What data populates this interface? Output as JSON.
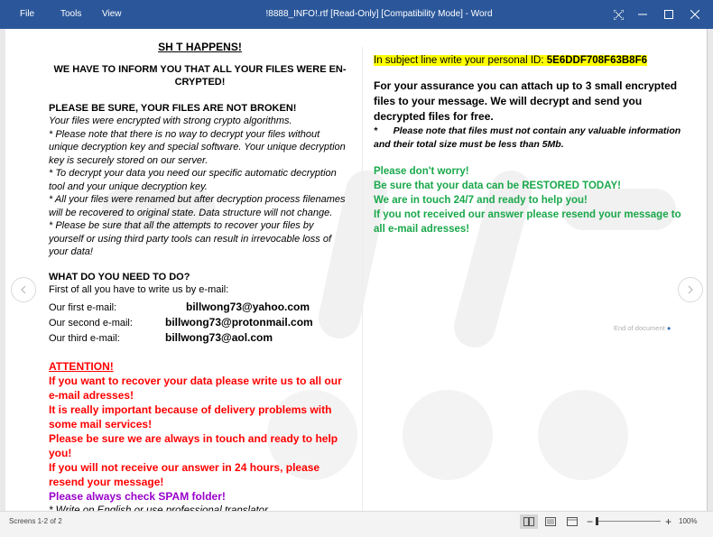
{
  "window": {
    "menu": [
      "File",
      "Tools",
      "View"
    ],
    "title": "!8888_INFO!.rtf [Read-Only] [Compatibility Mode] - Word"
  },
  "left": {
    "heading": "SH T HAPPENS!",
    "inform_line1": "WE HAVE TO INFORM YOU THAT ALL YOUR FILES WERE EN-",
    "inform_line2": "CRYPTED!",
    "sure_heading": "PLEASE BE SURE, YOUR FILES ARE NOT BROKEN!",
    "para1": "Your files were encrypted with strong crypto algorithms.",
    "para2": "* Please note that there is no way to decrypt your files without unique decryption key and special software. Your unique decryption key is securely stored on our server.",
    "para3": "* To decrypt your data you need our specific automatic decryption tool and your unique decryption key.",
    "para4": "* All your files were renamed but after decryption process filenames will be recovered to original state. Data structure will not change.",
    "para5": "* Please be sure that all the attempts to recover your files by yourself or using third party tools can result in irrevocable loss of your data!",
    "need_heading": "WHAT DO YOU NEED TO DO?",
    "first_line": "First of all you have to write us by e-mail:",
    "emails": [
      {
        "label": "Our first e-mail:",
        "value": "billwong73@yahoo.com"
      },
      {
        "label": "Our second e-mail:",
        "value": "billwong73@protonmail.com"
      },
      {
        "label": "Our third e-mail:",
        "value": "billwong73@aol.com"
      }
    ],
    "attention": "ATTENTION!",
    "red1": "If you want to recover your data please write us to all our e-mail adresses!",
    "red2": "It is really important because of delivery problems with some mail services!",
    "red3": "Please be sure we are always in touch and ready to help you!",
    "red4": "If you will not receive our answer in 24 hours, please resend your message!",
    "purple": "Please always check SPAM folder!",
    "footer": "* Write on English or use professional translator"
  },
  "right": {
    "subject_prefix": "In subject line write your personal ID: ",
    "personal_id": "5E6DDF708F63B8F6",
    "assurance": "For your assurance you can attach up to 3 small encrypted files to your message. We will decrypt and send you decrypted files for free.",
    "note_star": "*",
    "note": "Please note that files must not contain any valuable information and their total size must be less than 5Mb.",
    "green1": "Please don't worry!",
    "green2": "Be sure that your data can be RESTORED TODAY!",
    "green3": "We are in touch 24/7 and ready to help you!",
    "green4": "If you not received our answer please resend your message to all e-mail adresses!",
    "end_of_document": "End of document"
  },
  "status": {
    "screens": "Screens 1-2 of 2",
    "zoom": "100%"
  }
}
